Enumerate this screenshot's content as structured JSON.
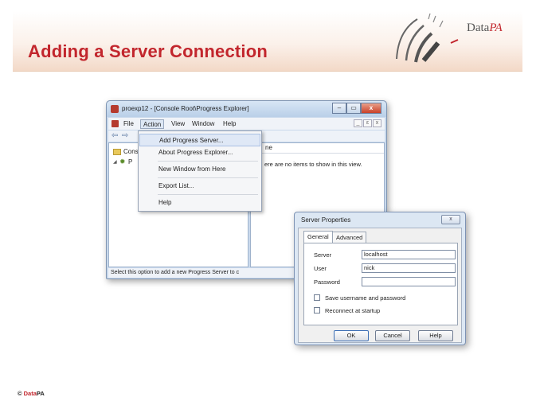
{
  "slide": {
    "title": "Adding a Server Connection",
    "logo": {
      "text_main": "Data",
      "text_accent": "PA"
    },
    "footer": {
      "copyright": "©",
      "brand_main": "Data",
      "brand_accent": "PA"
    }
  },
  "explorer": {
    "title": "proexp12 - [Console Root\\Progress Explorer]",
    "title_buttons": {
      "minimize": "–",
      "maximize": "▭",
      "close": "x"
    },
    "menu": [
      "File",
      "Action",
      "View",
      "Window",
      "Help"
    ],
    "active_menu": "Action",
    "mdi_buttons": {
      "minimize": "_",
      "restore": "ε",
      "close": "x"
    },
    "toolbar": {
      "back": "⇦",
      "forward": "⇨"
    },
    "tree": {
      "item1": "Cons",
      "item2": "P"
    },
    "list_header": "ne",
    "empty_message": "ere are no items to show in this view.",
    "status": "Select this option to add a new Progress Server to c"
  },
  "action_menu": {
    "items": [
      "Add Progress Server...",
      "About Progress Explorer...",
      "New Window from Here",
      "Export List...",
      "Help"
    ]
  },
  "dialog": {
    "title": "Server Properties",
    "close_label": "x",
    "tabs": [
      "General",
      "Advanced"
    ],
    "fields": [
      {
        "label": "Server",
        "value": "localhost"
      },
      {
        "label": "User",
        "value": "nick"
      },
      {
        "label": "Password",
        "value": ""
      }
    ],
    "checkboxes": [
      "Save username and password",
      "Reconnect at startup"
    ],
    "buttons": [
      "OK",
      "Cancel",
      "Help"
    ]
  }
}
